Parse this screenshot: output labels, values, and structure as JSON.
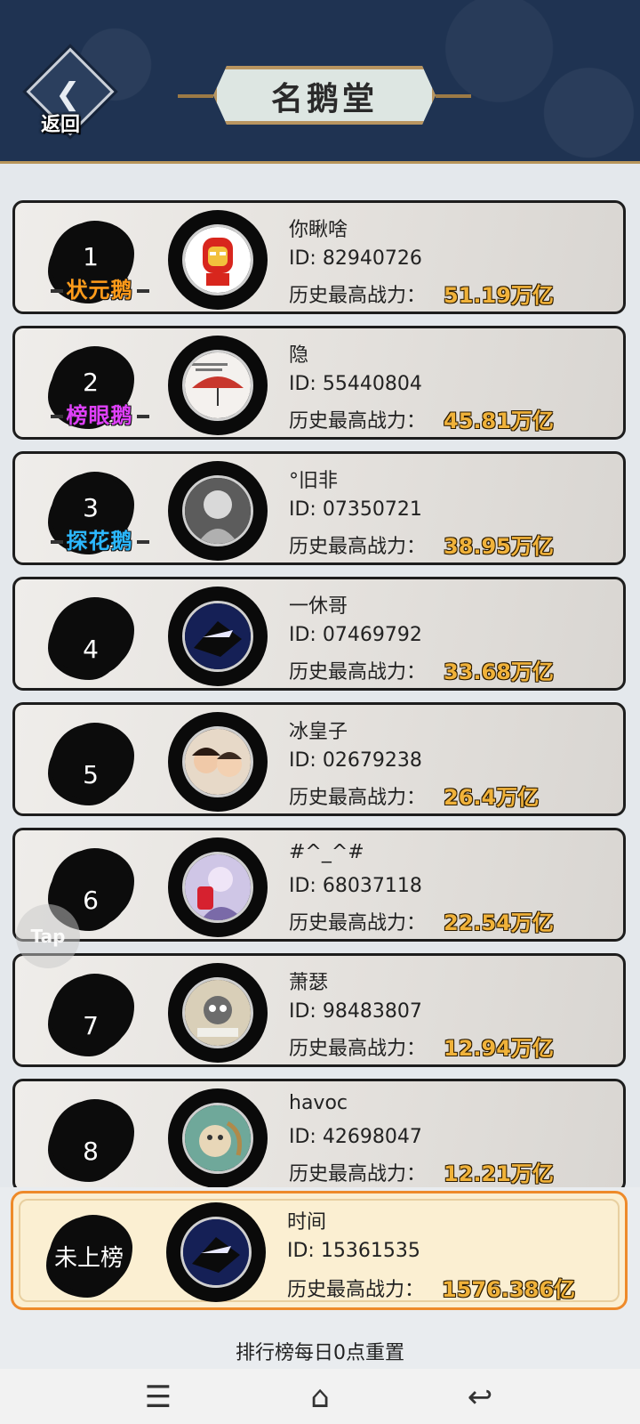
{
  "header": {
    "back_label": "返回",
    "title": "名鹅堂"
  },
  "power_label": "历史最高战力：",
  "ranking": [
    {
      "rank": "1",
      "rank_title": "状元鹅",
      "title_color": "#ff9b1a",
      "name": "你瞅啥",
      "id": "ID: 82940726",
      "power": "51.19万亿",
      "avatar_icon": "iron-man-avatar-icon"
    },
    {
      "rank": "2",
      "rank_title": "榜眼鹅",
      "title_color": "#e040fb",
      "name": "隐",
      "id": "ID: 55440804",
      "power": "45.81万亿",
      "avatar_icon": "umbrella-photo-avatar-icon"
    },
    {
      "rank": "3",
      "rank_title": "探花鹅",
      "title_color": "#2bb8ff",
      "name": "°旧非",
      "id": "ID: 07350721",
      "power": "38.95万亿",
      "avatar_icon": "anime-character-avatar-icon"
    },
    {
      "rank": "4",
      "rank_title": "",
      "title_color": "",
      "name": "一休哥",
      "id": "ID: 07469792",
      "power": "33.68万亿",
      "avatar_icon": "ninja-avatar-icon"
    },
    {
      "rank": "5",
      "rank_title": "",
      "title_color": "",
      "name": "冰皇子",
      "id": "ID: 02679238",
      "power": "26.4万亿",
      "avatar_icon": "kids-photo-avatar-icon"
    },
    {
      "rank": "6",
      "rank_title": "",
      "title_color": "",
      "name": "#^_^#",
      "id": "ID: 68037118",
      "power": "22.54万亿",
      "avatar_icon": "anime-girl-avatar-icon"
    },
    {
      "rank": "7",
      "rank_title": "",
      "title_color": "",
      "name": "萧瑟",
      "id": "ID: 98483807",
      "power": "12.94万亿",
      "avatar_icon": "cartoon-cat-avatar-icon"
    },
    {
      "rank": "8",
      "rank_title": "",
      "title_color": "",
      "name": "havoc",
      "id": "ID: 42698047",
      "power": "12.21万亿",
      "avatar_icon": "cat-illustration-avatar-icon"
    }
  ],
  "self": {
    "rank": "未上榜",
    "name": "时间",
    "id": "ID: 15361535",
    "power": "1576.386亿",
    "avatar_icon": "ninja-avatar-icon"
  },
  "footer_note": "排行榜每日0点重置",
  "watermark": "Tap",
  "nav": {
    "menu_icon": "☰",
    "home_icon": "⌂",
    "back_icon": "↩"
  }
}
